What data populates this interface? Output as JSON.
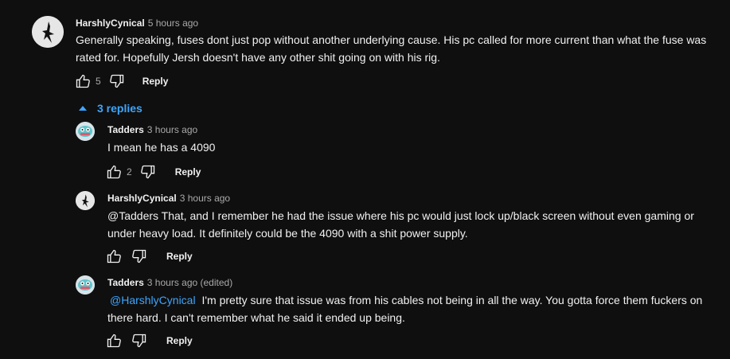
{
  "comment": {
    "author": "HarshlyCynical",
    "time": "5 hours ago",
    "text": "Generally speaking, fuses dont just pop without another underlying cause. His pc called for more current than what the fuse was rated for. Hopefully Jersh doesn't have any other shit going on with his rig.",
    "likes": "5",
    "reply_label": "Reply"
  },
  "replies_toggle": {
    "label": "3 replies",
    "icon": "caret-up-icon",
    "color": "#3ea6ff"
  },
  "replies": [
    {
      "author": "Tadders",
      "time": "3 hours ago",
      "text": "I mean he has a 4090",
      "likes": "2",
      "reply_label": "Reply"
    },
    {
      "author": "HarshlyCynical",
      "time": "3 hours ago",
      "text": "@Tadders That, and I remember he had the issue where his pc would just lock up/black screen without even gaming or under heavy load. It definitely could be the 4090 with a shit power supply.",
      "reply_label": "Reply"
    },
    {
      "author": "Tadders",
      "time": "3 hours ago (edited)",
      "mention": "@HarshlyCynical",
      "text": "I'm pretty sure that issue was from his cables not being in all the way. You gotta force them fuckers on there hard. I can't remember what he said it ended up being.",
      "reply_label": "Reply"
    }
  ],
  "colors": {
    "background": "#0f0f0f",
    "text": "#f1f1f1",
    "secondary": "#aaaaaa",
    "link": "#3ea6ff"
  }
}
